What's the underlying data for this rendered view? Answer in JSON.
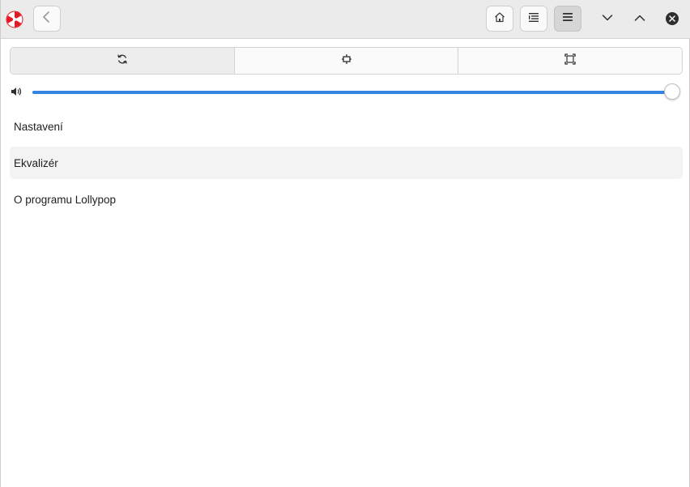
{
  "app": {
    "name": "Lollypop",
    "logo_icon": "lollypop-logo-icon"
  },
  "headerbar": {
    "back_icon": "go-back-icon",
    "home_icon": "home-icon",
    "list_icon": "list-view-icon",
    "menu_icon": "hamburger-menu-icon",
    "minimize_icon": "chevron-down-icon",
    "maximize_icon": "chevron-up-icon",
    "close_icon": "close-icon"
  },
  "tabs": [
    {
      "icon": "sync-icon",
      "active": true
    },
    {
      "icon": "mini-player-icon",
      "active": false
    },
    {
      "icon": "fullscreen-icon",
      "active": false
    }
  ],
  "volume": {
    "icon": "volume-high-icon",
    "level": 1.0
  },
  "menu": {
    "items": [
      {
        "label": "Nastavení"
      },
      {
        "label": "Ekvalizér"
      },
      {
        "label": "O programu Lollypop"
      }
    ]
  },
  "colors": {
    "accent": "#3584e4",
    "logo_red": "#e01b24",
    "headerbar_bg": "#ebebeb"
  }
}
